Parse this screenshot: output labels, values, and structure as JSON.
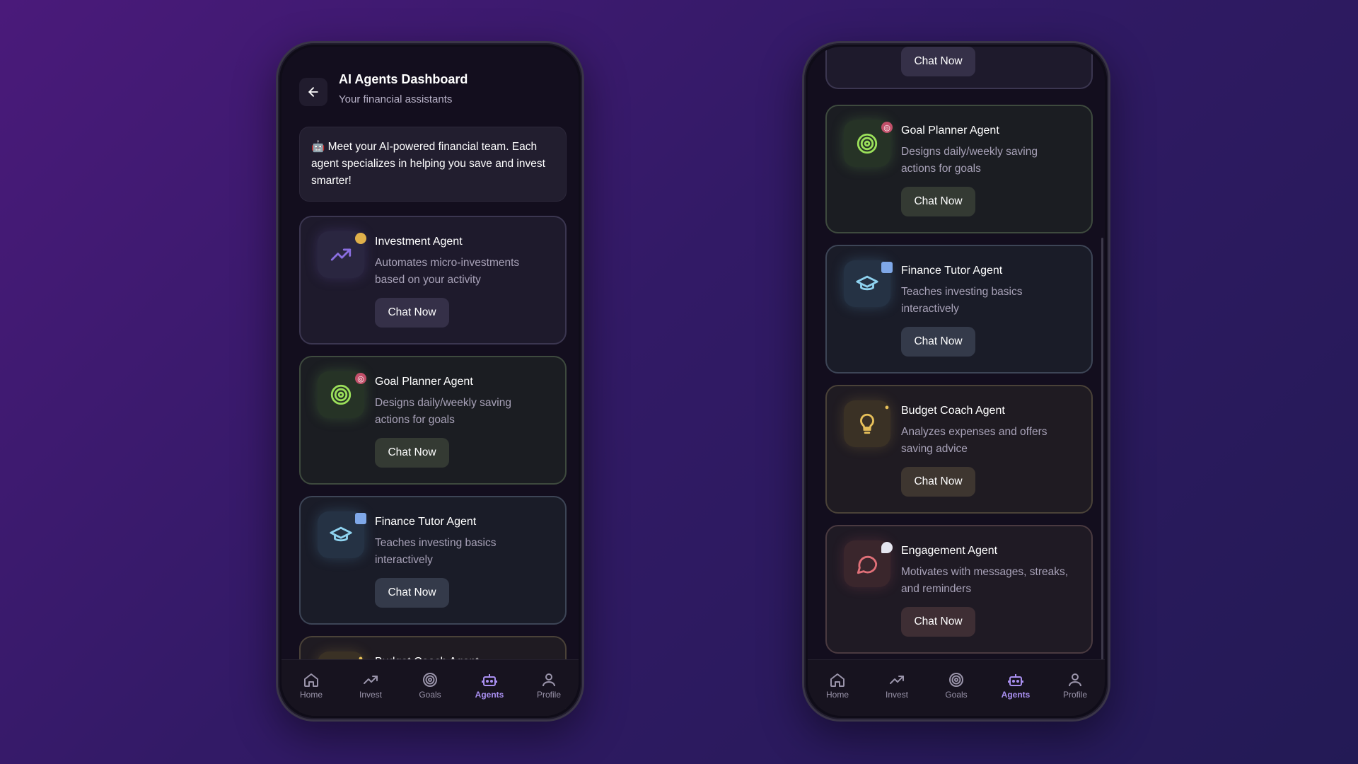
{
  "header": {
    "title": "AI Agents Dashboard",
    "subtitle": "Your financial assistants",
    "back_icon": "arrow-left-icon"
  },
  "intro": {
    "emoji": "🤖",
    "text": "Meet your AI-powered financial team. Each agent specializes in helping you save and invest smarter!"
  },
  "agents": [
    {
      "name": "Investment Agent",
      "desc": "Automates micro-investments based on your activity",
      "cta": "Chat Now",
      "icon": "trending-up-icon",
      "badge": "coin-icon",
      "color": "#8a6ee0"
    },
    {
      "name": "Goal Planner Agent",
      "desc": "Designs daily/weekly saving actions for goals",
      "cta": "Chat Now",
      "icon": "target-icon",
      "badge": "dart-icon",
      "color": "#9be05a"
    },
    {
      "name": "Finance Tutor Agent",
      "desc": "Teaches investing basics interactively",
      "cta": "Chat Now",
      "icon": "graduation-cap-icon",
      "badge": "book-icon",
      "color": "#8fd3f0"
    },
    {
      "name": "Budget Coach Agent",
      "desc": "Analyzes expenses and offers saving advice",
      "cta": "Chat Now",
      "icon": "lightbulb-icon",
      "badge": "bulb-badge-icon",
      "color": "#e8c15a"
    },
    {
      "name": "Engagement Agent",
      "desc": "Motivates with messages, streaks, and reminders",
      "cta": "Chat Now",
      "icon": "message-circle-icon",
      "badge": "speech-bubble-icon",
      "color": "#e07078"
    }
  ],
  "partial_top_cta": "Chat Now",
  "nav": [
    {
      "label": "Home",
      "icon": "home-icon",
      "active": false
    },
    {
      "label": "Invest",
      "icon": "trending-up-icon",
      "active": false
    },
    {
      "label": "Goals",
      "icon": "target-icon",
      "active": false
    },
    {
      "label": "Agents",
      "icon": "robot-icon",
      "active": true
    },
    {
      "label": "Profile",
      "icon": "user-icon",
      "active": false
    }
  ],
  "colors": {
    "background": "#321a66",
    "accent": "#a98ff0",
    "card": "#1d1a28"
  }
}
